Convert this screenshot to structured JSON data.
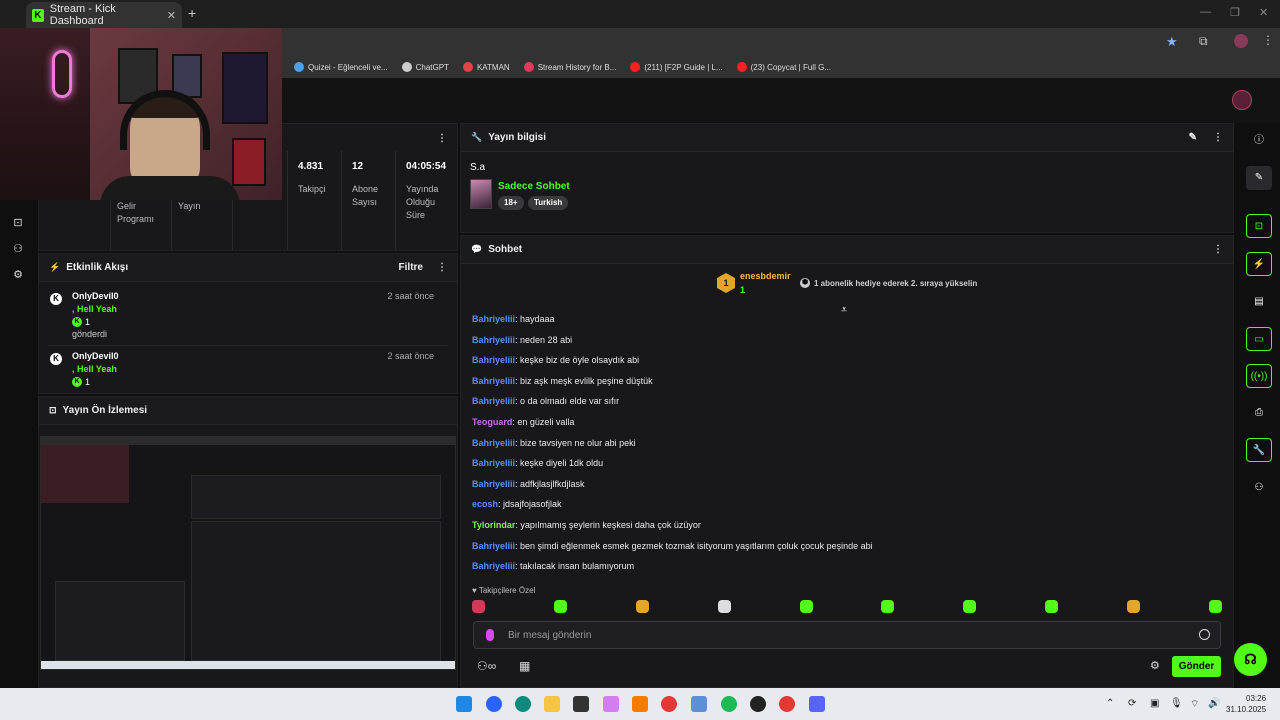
{
  "browser": {
    "tab_title": "Stream - Kick Dashboard",
    "bookmarks": [
      "Quizei - Eğlenceli ve...",
      "ChatGPT",
      "KATMAN",
      "Stream History for B...",
      "(211) [F2P Guide | L...",
      "(23) Copycat | Full G..."
    ]
  },
  "stats": {
    "followers_value": "4.831",
    "followers_label": "Takipçi",
    "subs_value": "12",
    "subs_label": "Abone Sayısı",
    "time_value": "04:05:54",
    "time_label": "Yayında Olduğu Süre",
    "income_label": "Gelir Programı",
    "stream_label": "Yayın"
  },
  "activity": {
    "title": "Etkinlik Akışı",
    "filter_label": "Filtre",
    "events": [
      {
        "name": "OnlyDevil0",
        "sub": ", Hell Yeah",
        "amount": "1",
        "action": "gönderdi",
        "time": "2 saat önce"
      },
      {
        "name": "OnlyDevil0",
        "sub": ", Hell Yeah",
        "amount": "1",
        "action": "",
        "time": "2 saat önce"
      }
    ]
  },
  "preview": {
    "title": "Yayın Ön İzlemesi"
  },
  "stream_info": {
    "header": "Yayın bilgisi",
    "title": "S.a",
    "category": "Sadece Sohbet",
    "tags": [
      "18+",
      "Turkish"
    ]
  },
  "chat": {
    "header": "Sohbet",
    "pinned_user": "enesbdemir",
    "pinned_badge": "1",
    "pinned_count": "1",
    "pinned_message": "1 abonelik hediye ederek 2. sıraya yükselin",
    "messages": [
      {
        "user": "Bahriyeliii",
        "text": ": haydaaa",
        "color": "#5b8cff"
      },
      {
        "user": "Bahriyeliii",
        "text": ": neden 28 abi",
        "color": "#5b8cff"
      },
      {
        "user": "Bahriyeliii",
        "text": ": keşke biz de öyle olsaydık abi",
        "color": "#5b8cff"
      },
      {
        "user": "Bahriyeliii",
        "text": ": biz aşk meşk evlilk peşine düştük",
        "color": "#5b8cff"
      },
      {
        "user": "Bahriyeliii",
        "text": ": o da olmadı elde var sıfır",
        "color": "#5b8cff"
      },
      {
        "user": "Teoguard",
        "text": ": en güzeli valla",
        "color": "#c86bf0"
      },
      {
        "user": "Bahriyeliii",
        "text": ": bize tavsiyen ne olur abi peki",
        "color": "#5b8cff"
      },
      {
        "user": "Bahriyeliii",
        "text": ": keşke diyeli 1dk oldu",
        "color": "#5b8cff"
      },
      {
        "user": "Bahriyeliii",
        "text": ": adfkjlasjlfkdjlask",
        "color": "#5b8cff"
      },
      {
        "user": "ecosh",
        "text": ": jdsajfojasofjlak",
        "color": "#5b8cff"
      },
      {
        "user": "Tylorindar",
        "text": ": yapılmamış şeylerin keşkesi daha çok üzüyor",
        "color": "#7df25a"
      },
      {
        "user": "Bahriyeliii",
        "text": ": ben şimdi eğlenmek esmek gezmek tozmak isityorum yaşıtlarım çoluk çocuk peşinde abi",
        "color": "#5b8cff"
      },
      {
        "user": "Bahriyeliii",
        "text": ": takılacak insan bulamıyorum",
        "color": "#5b8cff"
      }
    ],
    "followers_only": "Takipçilere Özel",
    "input_placeholder": "Bir mesaj gönderin",
    "send_label": "Gönder"
  },
  "colors": {
    "accent": "#53fc18",
    "background": "#0f0f10",
    "panel": "#18181b"
  },
  "taskbar": {
    "time": "03:26",
    "date": "31.10.2025"
  }
}
